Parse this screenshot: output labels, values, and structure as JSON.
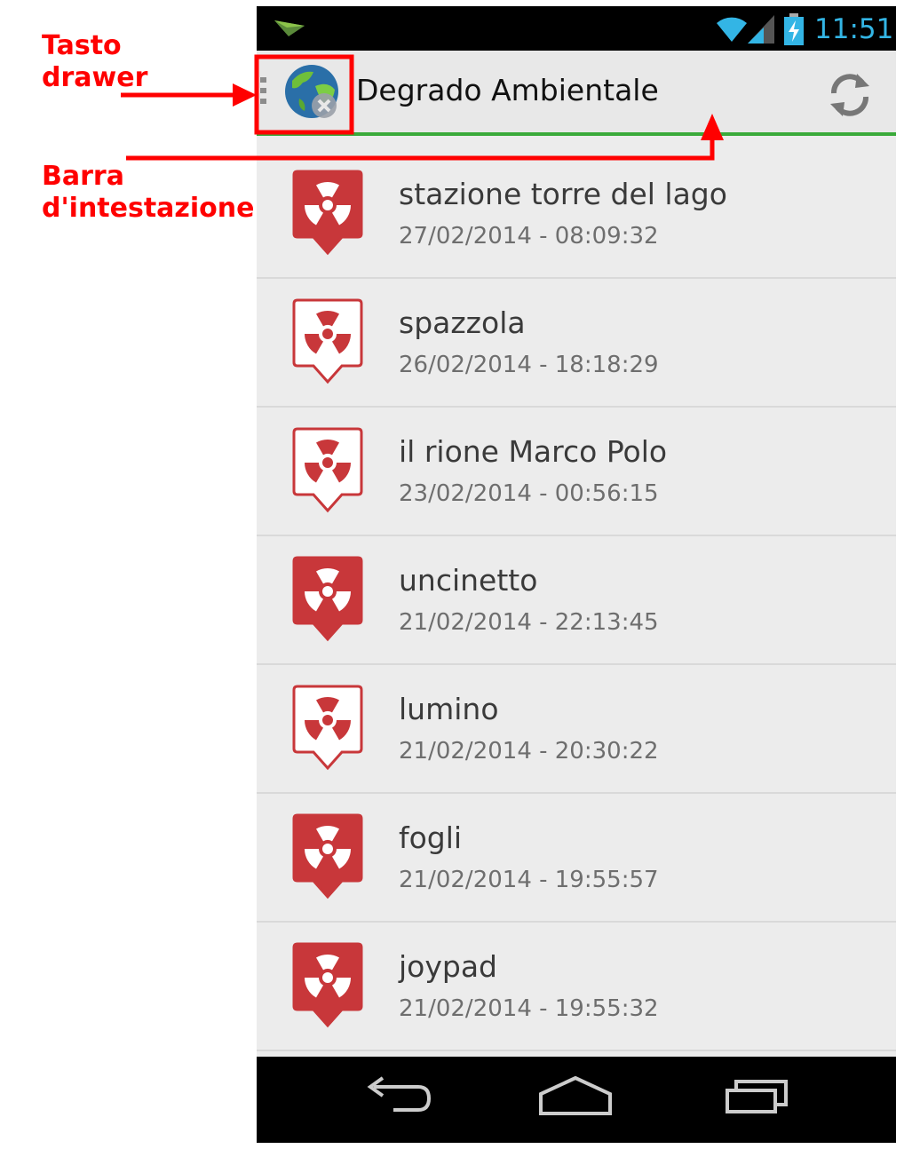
{
  "annotations": {
    "drawer_label": "Tasto\ndrawer",
    "header_label": "Barra\nd'intestazione",
    "color": "#ff0000"
  },
  "status_bar": {
    "time": "11:51",
    "icons": [
      "notification-icon",
      "wifi-icon",
      "signal-icon",
      "battery-charging-icon"
    ],
    "accent": "#33b5e5"
  },
  "action_bar": {
    "title": "Degrado Ambientale",
    "icons": [
      "drawer-indicator-icon",
      "app-globe-icon",
      "refresh-icon"
    ],
    "underline_color": "#3aaa3a"
  },
  "reports": [
    {
      "title": "stazione torre del lago",
      "date": "27/02/2014 - 08:09:32",
      "icon": "radiation-marker-filled"
    },
    {
      "title": "spazzola",
      "date": "26/02/2014 - 18:18:29",
      "icon": "radiation-marker-outline"
    },
    {
      "title": "il rione Marco Polo",
      "date": "23/02/2014 - 00:56:15",
      "icon": "radiation-marker-outline"
    },
    {
      "title": "uncinetto",
      "date": "21/02/2014 - 22:13:45",
      "icon": "radiation-marker-filled"
    },
    {
      "title": "lumino",
      "date": "21/02/2014 - 20:30:22",
      "icon": "radiation-marker-outline"
    },
    {
      "title": "fogli",
      "date": "21/02/2014 - 19:55:57",
      "icon": "radiation-marker-filled"
    },
    {
      "title": "joypad",
      "date": "21/02/2014 - 19:55:32",
      "icon": "radiation-marker-filled"
    }
  ],
  "nav_bar": {
    "icons": [
      "back-icon",
      "home-icon",
      "recents-icon"
    ]
  },
  "marker_color": "#c8373a"
}
